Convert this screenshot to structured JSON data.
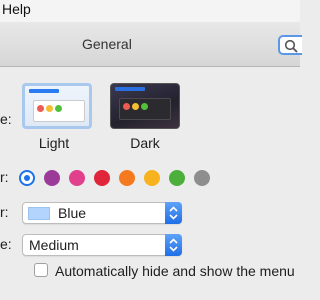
{
  "menubar": {
    "menu_item": "Help"
  },
  "window": {
    "title": "General"
  },
  "rows": {
    "appearance_label": "e:",
    "accent_label": "r:",
    "highlight_label": "r:",
    "sidebar_label": "e:"
  },
  "appearance": {
    "options": [
      {
        "label": "Light",
        "selected": true
      },
      {
        "label": "Dark",
        "selected": false
      }
    ]
  },
  "accent_colors": [
    {
      "color": "#1a73e8",
      "selected": true
    },
    {
      "color": "#9c3a9a",
      "selected": false
    },
    {
      "color": "#e0408c",
      "selected": false
    },
    {
      "color": "#e0243a",
      "selected": false
    },
    {
      "color": "#f57a1f",
      "selected": false
    },
    {
      "color": "#f7b21e",
      "selected": false
    },
    {
      "color": "#4caf3c",
      "selected": false
    },
    {
      "color": "#8e8e8e",
      "selected": false
    }
  ],
  "highlight_color": {
    "value": "Blue",
    "swatch": "#b3d4fc"
  },
  "sidebar_icon_size": {
    "value": "Medium"
  },
  "auto_hide_menu": {
    "label": "Automatically hide and show the menu",
    "checked": false
  },
  "icons": {
    "search": "search-icon",
    "popup_arrows": "chevron-updown-icon"
  }
}
